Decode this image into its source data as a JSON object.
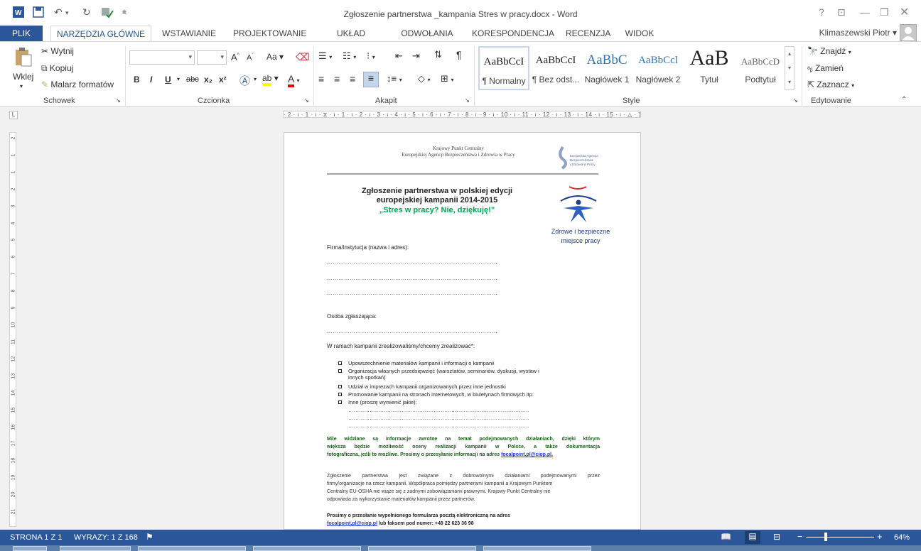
{
  "window": {
    "title": "Zgłoszenie partnerstwa _kampania Stres w pracy.docx - Word",
    "help": "?",
    "user": "Klimaszewski Piotr"
  },
  "tabs": [
    {
      "label": "PLIK"
    },
    {
      "label": "NARZĘDZIA GŁÓWNE"
    },
    {
      "label": "WSTAWIANIE"
    },
    {
      "label": "PROJEKTOWANIE"
    },
    {
      "label": "UKŁAD STRONY"
    },
    {
      "label": "ODWOŁANIA"
    },
    {
      "label": "KORESPONDENCJA"
    },
    {
      "label": "RECENZJA"
    },
    {
      "label": "WIDOK"
    }
  ],
  "clipboard": {
    "paste": "Wklej",
    "cut": "Wytnij",
    "copy": "Kopiuj",
    "format_painter": "Malarz formatów",
    "label": "Schowek"
  },
  "font": {
    "label": "Czcionka",
    "bold": "B",
    "italic": "I",
    "underline": "U",
    "strike": "abc",
    "sub": "x₂",
    "sup": "x²",
    "case": "Aa",
    "grow": "A",
    "shrink": "A"
  },
  "paragraph": {
    "label": "Akapit"
  },
  "styles": {
    "label": "Style",
    "items": [
      {
        "sample": "AaBbCcI",
        "name": "¶ Normalny"
      },
      {
        "sample": "AaBbCcI",
        "name": "¶ Bez odst..."
      },
      {
        "sample": "AaBbC",
        "name": "Nagłówek 1"
      },
      {
        "sample": "AaBbCcl",
        "name": "Nagłówek 2"
      },
      {
        "sample": "AaB",
        "name": "Tytuł"
      },
      {
        "sample": "AaBbCcD",
        "name": "Podtytuł"
      }
    ]
  },
  "editing": {
    "label": "Edytowanie",
    "find": "Znajdź",
    "replace": "Zamień",
    "select": "Zaznacz"
  },
  "ruler": {
    "horizontal": "· 2 · ı · 1 · ı · ⧖ · ı · 1 · ı · 2 · ı · 3 · ı · 4 · ı · 5 · ı · 6 · ı · 7 · ı · 8 · ı · 9 · ı · 10 · ı · 11 · ı · 12 · ı · 13 · ı · 14 · ı · 15 · ı · △ · 17 · ı · 18 ·",
    "vertical": [
      "2",
      "1",
      "1",
      "2",
      "3",
      "4",
      "5",
      "6",
      "7",
      "8",
      "9",
      "10",
      "11",
      "12",
      "13",
      "14",
      "15",
      "16",
      "17",
      "18",
      "19",
      "20",
      "21"
    ]
  },
  "document": {
    "header_line1": "Krajowy Punkt Centralny",
    "header_line2": "Europejskiej Agencji Bezpieczeństwa i Zdrowia w Pracy",
    "logo_small": [
      "Europejska Agencja",
      "Bezpieczeństwa",
      "i Zdrowia w Pracy"
    ],
    "title_line1": "Zgłoszenie partnerstwa w polskiej edycji",
    "title_line2": "europejskiej kampanii 2014-2015",
    "title_line3": "„Stres w pracy? Nie, dziękuję!”",
    "logo_caption_1": "Zdrowe i bezpieczne",
    "logo_caption_2": "miejsce pracy",
    "field_company": "Firma/instytucja (nazwa i adres):",
    "dots_long": "………………………………………………………………………………",
    "field_person": "Osoba zgłaszająca:",
    "activities_intro": "W ramach kampanii zrealizowaliśmy/chcemy zrealizować*:",
    "activities": [
      "Upowszechnienie materiałów kampanii i informacji o kampanii",
      "Organizacja własnych przedsięwzięć (warsztatów, seminariów, dyskusji, wystaw i",
      "Udział w imprezach kampanii organizowanych przez inne jednostki",
      "Promowanie kampanii na stronach internetowych, w biuletynach firmowych itp.",
      "Inne (proszę wymienić jakie):"
    ],
    "activity_cont": "innych spotkań)",
    "dots_other": "…………………………………………………………………………………………",
    "green_1": "Mile widziane są informacje zwrotne na temat podejmowanych działaniach, dzięki którym",
    "green_2": "większa będzie możliwość oceny realizacji kampanii w Polsce, a także dokumentacja",
    "green_3": "fotograficzna, jeśli to możliwe. Prosimy o przesyłanie informacji na adres ",
    "email": "focalpoint.pl@ciop.pl.",
    "info_1": "Zgłoszenie partnerstwa jest związane z dobrowolnymi działaniami podejmowanymi przez",
    "info_2": "firmy/organizacje na rzecz kampanii. Współpraca pomiędzy partnerami kampanii a Krajowym Punktem",
    "info_3": "Centralny EU-OSHA nie wiąże się z żadnymi zobowiązaniami prawnymi. Krajowy Punkt Centralny nie",
    "info_4": "odpowiada za wykorzystanie materiałów kampanii przez partnerów.",
    "send_1": "Prosimy o przesłanie wypełnionego formularza pocztą elektroniczną na adres",
    "send_email": "focalpoint.pl@ciop.pl",
    "send_2": " lub faksem pod numer: +48 22 623 36 98"
  },
  "status": {
    "page": "STRONA 1 Z 1",
    "words": "WYRAZY: 1 Z 168",
    "zoom": "64%"
  },
  "colors": {
    "accent": "#2b579a",
    "green": "#00a650",
    "dark_green": "#1a5e1a",
    "link": "#1f3bc7"
  }
}
